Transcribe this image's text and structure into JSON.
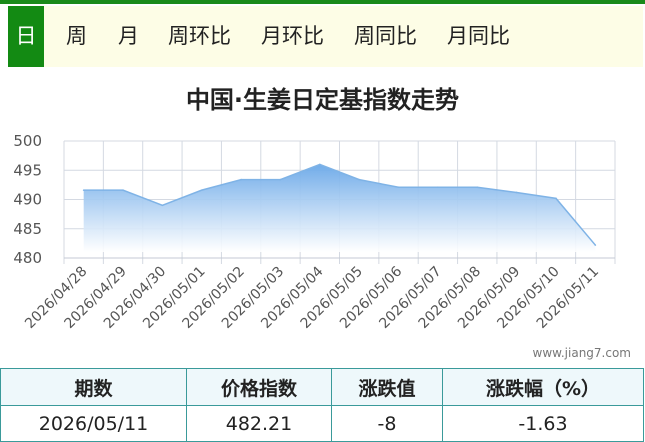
{
  "tabs": [
    {
      "label": "日",
      "active": true
    },
    {
      "label": "周",
      "active": false
    },
    {
      "label": "月",
      "active": false
    },
    {
      "label": "周环比",
      "active": false
    },
    {
      "label": "月环比",
      "active": false
    },
    {
      "label": "周同比",
      "active": false
    },
    {
      "label": "月同比",
      "active": false
    }
  ],
  "watermark": "www.jiang7.com",
  "colors": {
    "accent": "#138a13",
    "tab_bg": "#fdfde6",
    "line": "#7fb3e6",
    "table_border": "#3a9a9a"
  },
  "chart_data": {
    "type": "area",
    "title": "中国·生姜日定基指数走势",
    "x": [
      "2026/04/28",
      "2026/04/29",
      "2026/04/30",
      "2026/05/01",
      "2026/05/02",
      "2026/05/03",
      "2026/05/04",
      "2026/05/05",
      "2026/05/06",
      "2026/05/07",
      "2026/05/08",
      "2026/05/09",
      "2026/05/10",
      "2026/05/11"
    ],
    "series": [
      {
        "values": [
          491.6,
          491.6,
          489.0,
          491.6,
          493.4,
          493.4,
          496.0,
          493.4,
          492.1,
          492.1,
          492.1,
          491.2,
          490.2,
          482.21
        ]
      }
    ],
    "ylim": [
      480,
      500
    ],
    "yticks": [
      480,
      485,
      490,
      495,
      500
    ],
    "grid": true
  },
  "table": {
    "headers": [
      "期数",
      "价格指数",
      "涨跌值",
      "涨跌幅（%）"
    ],
    "row": [
      "2026/05/11",
      "482.21",
      "-8",
      "-1.63"
    ]
  }
}
